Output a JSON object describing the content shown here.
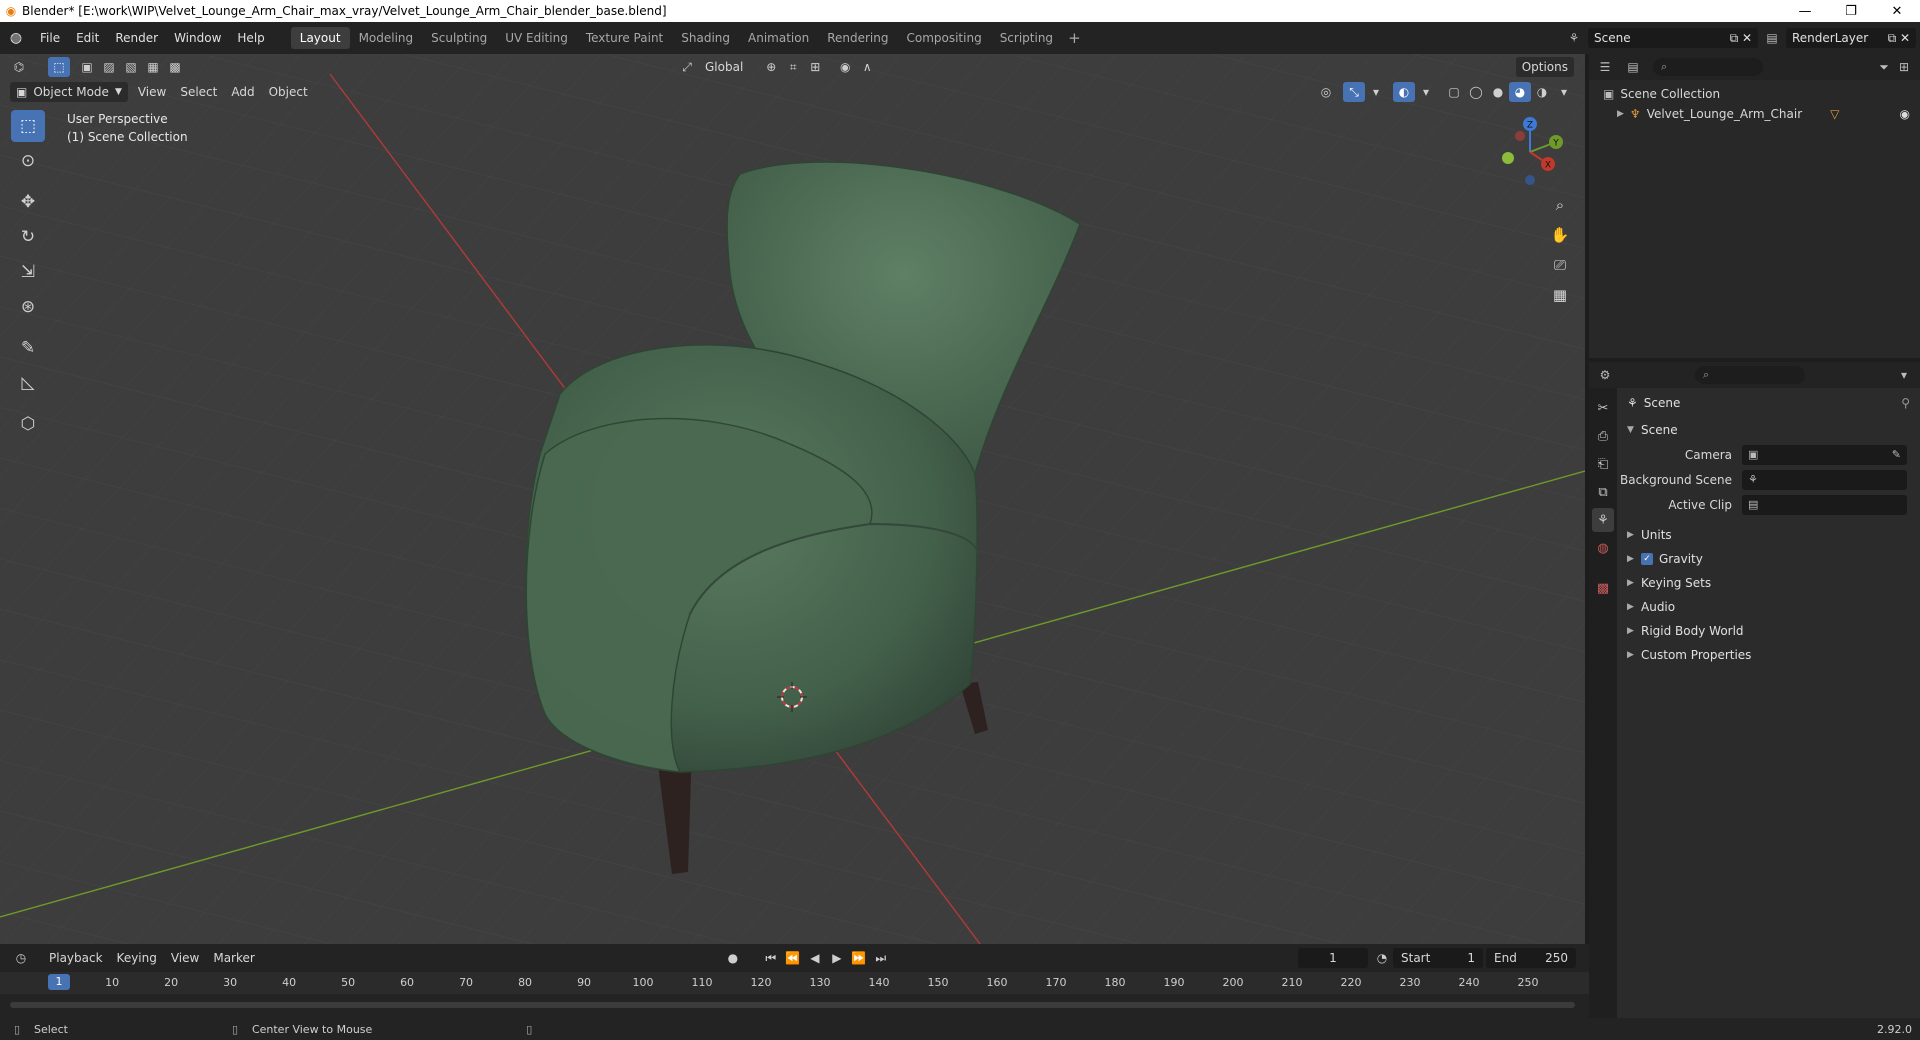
{
  "window": {
    "title": "Blender* [E:\\work\\WIP\\Velvet_Lounge_Arm_Chair_max_vray/Velvet_Lounge_Arm_Chair_blender_base.blend]",
    "minimize_icon": "—",
    "restore_icon": "❐",
    "close_icon": "✕"
  },
  "menu": [
    "File",
    "Edit",
    "Render",
    "Window",
    "Help"
  ],
  "workspaces": [
    "Layout",
    "Modeling",
    "Sculpting",
    "UV Editing",
    "Texture Paint",
    "Shading",
    "Animation",
    "Rendering",
    "Compositing",
    "Scripting"
  ],
  "active_workspace": "Layout",
  "scene_name": "Scene",
  "render_layer": "RenderLayer",
  "viewport": {
    "mode": "Object Mode",
    "menus": [
      "View",
      "Select",
      "Add",
      "Object"
    ],
    "orientation": "Global",
    "options": "Options",
    "perspective_label": "User Perspective",
    "collection_label": "(1) Scene Collection",
    "gizmo_axes": {
      "x": "X",
      "y": "Y",
      "z": "Z"
    }
  },
  "outliner": {
    "root": "Scene Collection",
    "items": [
      {
        "name": "Velvet_Lounge_Arm_Chair"
      }
    ]
  },
  "properties": {
    "context": "Scene",
    "panel": "Scene",
    "rows": [
      {
        "label": "Camera"
      },
      {
        "label": "Background Scene"
      },
      {
        "label": "Active Clip"
      }
    ],
    "subpanels": [
      "Units",
      "Gravity",
      "Keying Sets",
      "Audio",
      "Rigid Body World",
      "Custom Properties"
    ]
  },
  "timeline": {
    "menus": [
      "Playback",
      "Keying",
      "View",
      "Marker"
    ],
    "current_frame": "1",
    "start_label": "Start",
    "start": "1",
    "end_label": "End",
    "end": "250",
    "ticks": [
      "1",
      "10",
      "20",
      "30",
      "40",
      "50",
      "60",
      "70",
      "80",
      "90",
      "100",
      "110",
      "120",
      "130",
      "140",
      "150",
      "160",
      "170",
      "180",
      "190",
      "200",
      "210",
      "220",
      "230",
      "240",
      "250"
    ]
  },
  "status": {
    "left": "Select",
    "middle": "Center View to Mouse",
    "version": "2.92.0"
  },
  "colors": {
    "accent": "#4772b3",
    "x_axis": "#c0392b",
    "y_axis": "#6f9a2a",
    "chair": "#4d6b52"
  }
}
